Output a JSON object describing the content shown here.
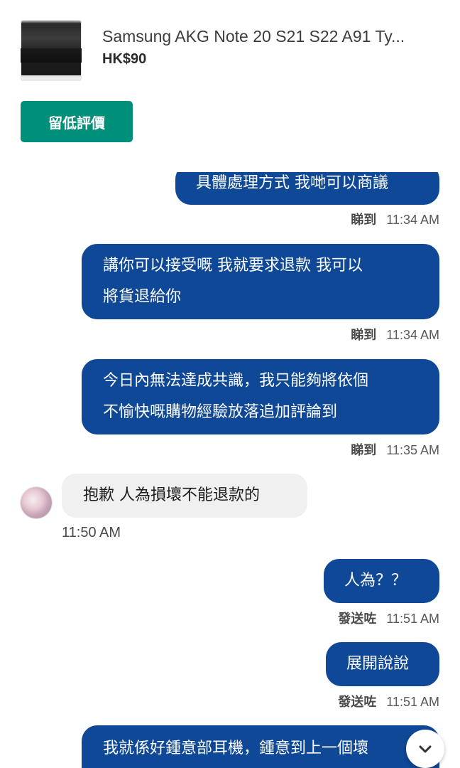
{
  "listing": {
    "title": "Samsung AKG Note 20 S21 S22 A91 Ty...",
    "price": "HK$90"
  },
  "actions": {
    "review_label": "留低評價"
  },
  "messages": [
    {
      "direction": "out",
      "lines": [
        "具體處理方式 我哋可以商議"
      ],
      "status": "睇到",
      "time": "11:34 AM"
    },
    {
      "direction": "out",
      "lines": [
        "講你可以接受嘅 我就要求退款 我可以",
        "將貨退給你"
      ],
      "status": "睇到",
      "time": "11:34 AM"
    },
    {
      "direction": "out",
      "lines": [
        "今日內無法達成共識，我只能夠將依個",
        "不愉快嘅購物經驗放落追加評論到"
      ],
      "status": "睇到",
      "time": "11:35 AM"
    },
    {
      "direction": "in",
      "lines": [
        "抱歉 人為損壞不能退款的"
      ],
      "time": "11:50 AM"
    },
    {
      "direction": "out",
      "lines": [
        "人為？？"
      ],
      "status": "發送咗",
      "time": "11:51 AM"
    },
    {
      "direction": "out",
      "lines": [
        "展開說說"
      ],
      "status": "發送咗",
      "time": "11:51 AM"
    },
    {
      "direction": "out",
      "lines": [
        "我就係好鍾意部耳機，鍾意到上一個壞"
      ]
    }
  ],
  "colors": {
    "accent": "#008f79",
    "outgoing_bubble": "#0f4897",
    "incoming_bubble": "#f0f0f0"
  },
  "icons": {
    "scroll_down": "chevron-down-icon"
  }
}
